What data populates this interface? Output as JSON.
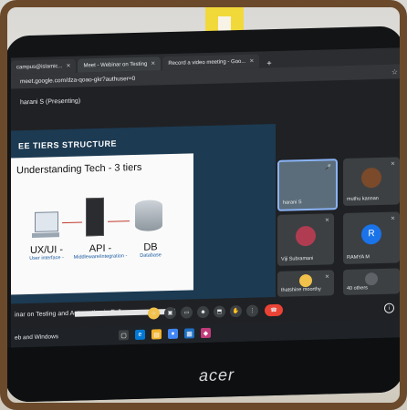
{
  "browser": {
    "tabs": [
      {
        "label": "campus@islamic...",
        "active": false
      },
      {
        "label": "Meet - Webinar on Testing",
        "active": true
      },
      {
        "label": "Record a video meeting - Goo...",
        "active": false
      }
    ],
    "new_tab": "+",
    "url": "meet.google.com/dza-qoao-gkr?authuser=0"
  },
  "meet": {
    "presenting_label": "harani S (Presenting)",
    "meeting_name": "inar on Testing and Automation in Full ...",
    "info_icon": "i"
  },
  "slide": {
    "title": "EE TIERS STRUCTURE",
    "subtitle": "Understanding Tech - 3 tiers",
    "tiers": [
      {
        "label": "UX/UI -",
        "caption": "User interface -"
      },
      {
        "label": "API -",
        "caption": "Middleware/integration -"
      },
      {
        "label": "DB",
        "caption": "Database"
      }
    ]
  },
  "participants": [
    {
      "name": "harani S",
      "self": true
    },
    {
      "name": "muthu kannan"
    },
    {
      "name": "Viji Subramani"
    },
    {
      "name": "RAMYA M",
      "initial": "R"
    },
    {
      "name": "thatshine moorthy"
    },
    {
      "name": "40 others"
    }
  ],
  "taskbar": {
    "search_text": "eb and Windows"
  },
  "monitor_brand": "acer",
  "colors": {
    "end_call": "#ea4335",
    "accent": "#8ab4f8",
    "avatar_blue": "#1a73e8"
  }
}
